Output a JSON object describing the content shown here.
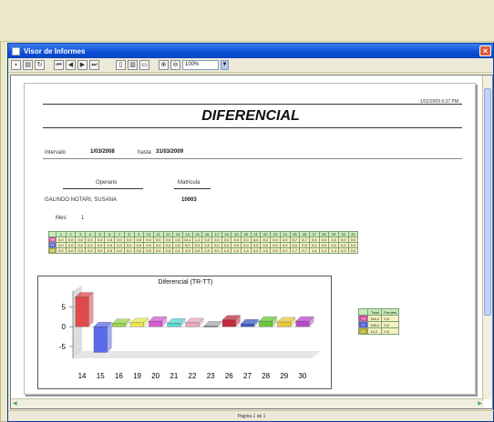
{
  "window": {
    "title": "Visor de Informes",
    "close_label": "×"
  },
  "toolbar": {
    "zoom_value": "100%"
  },
  "report": {
    "timestamp": "1/02/2009 6:37 PM",
    "title": "DIFERENCIAL",
    "interval_label": "Intervalo",
    "from_date": "1/03/2008",
    "to_label": "hasta",
    "to_date": "31/03/2009",
    "operator_header": "Operario",
    "matricula_header": "Matricula",
    "operator_name": "GALINDO NOTARI, SUSANA",
    "matricula_value": "10003",
    "month_label": "Mes:",
    "month_value": "1"
  },
  "grid": {
    "days": [
      "1",
      "2",
      "3",
      "4",
      "5",
      "6",
      "7",
      "8",
      "9",
      "10",
      "11",
      "12",
      "13",
      "14",
      "15",
      "16",
      "17",
      "18",
      "19",
      "20",
      "21",
      "22",
      "23",
      "24",
      "25",
      "26",
      "27",
      "28",
      "29",
      "30",
      "31"
    ],
    "rows": [
      {
        "label": "TR",
        "color": "#d44a9a",
        "values": [
          "0,0",
          "0,0",
          "0,0",
          "0,0",
          "0,0",
          "0,0",
          "0,0",
          "0,0",
          "0,0",
          "0,0",
          "0,0",
          "0,0",
          "0,0",
          "14,1",
          "1,1",
          "0,0",
          "0,0",
          "0,0",
          "8,3",
          "0,0",
          "8,4",
          "8,2",
          "0,0",
          "0,0",
          "8,7",
          "8,7",
          "0,4",
          "0,0",
          "0,4",
          "0,0",
          "0,0"
        ]
      },
      {
        "label": "TT",
        "color": "#5a5adc",
        "values": [
          "0,0",
          "0,0",
          "0,0",
          "0,0",
          "0,0",
          "0,0",
          "0,0",
          "0,0",
          "0,0",
          "0,0",
          "0,0",
          "0,0",
          "0,0",
          "9,0",
          "0,0",
          "0,0",
          "0,0",
          "0,0",
          "0,0",
          "0,0",
          "0,0",
          "0,0",
          "0,0",
          "0,0",
          "0,0",
          "0,0",
          "0,0",
          "0,0",
          "0,0",
          "0,0",
          "0,0"
        ]
      },
      {
        "label": "DF",
        "color": "#b8a830",
        "values": [
          "0,0",
          "0,0",
          "0,0",
          "0,0",
          "0,0",
          "0,0",
          "0,0",
          "0,0",
          "0,0",
          "0,0",
          "0,0",
          "0,0",
          "0,1",
          "4,9",
          "0,0",
          "0,0",
          "0,0",
          "1,0",
          "1,0",
          "1,4",
          "0,2",
          "0,0",
          "0,0",
          "0,0",
          "1,7",
          "0,7",
          "1,4",
          "1,2",
          "1,4",
          "0,0",
          "0,0"
        ]
      }
    ]
  },
  "chart_data": {
    "type": "bar",
    "title": "Diferencial (TR-TT)",
    "categories": [
      "14",
      "15",
      "16",
      "19",
      "20",
      "21",
      "22",
      "23",
      "26",
      "27",
      "28",
      "29",
      "30"
    ],
    "values": [
      7.5,
      -6.5,
      0.8,
      1.0,
      1.4,
      0.9,
      1.0,
      0.2,
      1.7,
      0.7,
      1.4,
      1.2,
      1.4
    ],
    "colors": [
      "#e04a4a",
      "#5a6ae8",
      "#9cd44a",
      "#e8e84a",
      "#d45ad4",
      "#5ad4d4",
      "#e8a8b8",
      "#aaaaaa",
      "#c02a3a",
      "#3a5ac8",
      "#6ac83a",
      "#e8c83a",
      "#b84ac8"
    ],
    "ytick_labels": [
      "5",
      "0",
      "-5"
    ],
    "ylim": [
      -8,
      9
    ]
  },
  "legend": {
    "headers": [
      "Total",
      "Porcent"
    ],
    "rows": [
      {
        "label": "TR",
        "color": "#d44a9a",
        "total": "116,2",
        "porcent": "0,0"
      },
      {
        "label": "TT",
        "color": "#5a5adc",
        "total": "104,0",
        "porcent": "0,0"
      },
      {
        "label": "DF",
        "color": "#b8a830",
        "total": "12,2",
        "porcent": "0,0"
      }
    ]
  },
  "status": {
    "page_text": "Pagina 1 de 1"
  }
}
